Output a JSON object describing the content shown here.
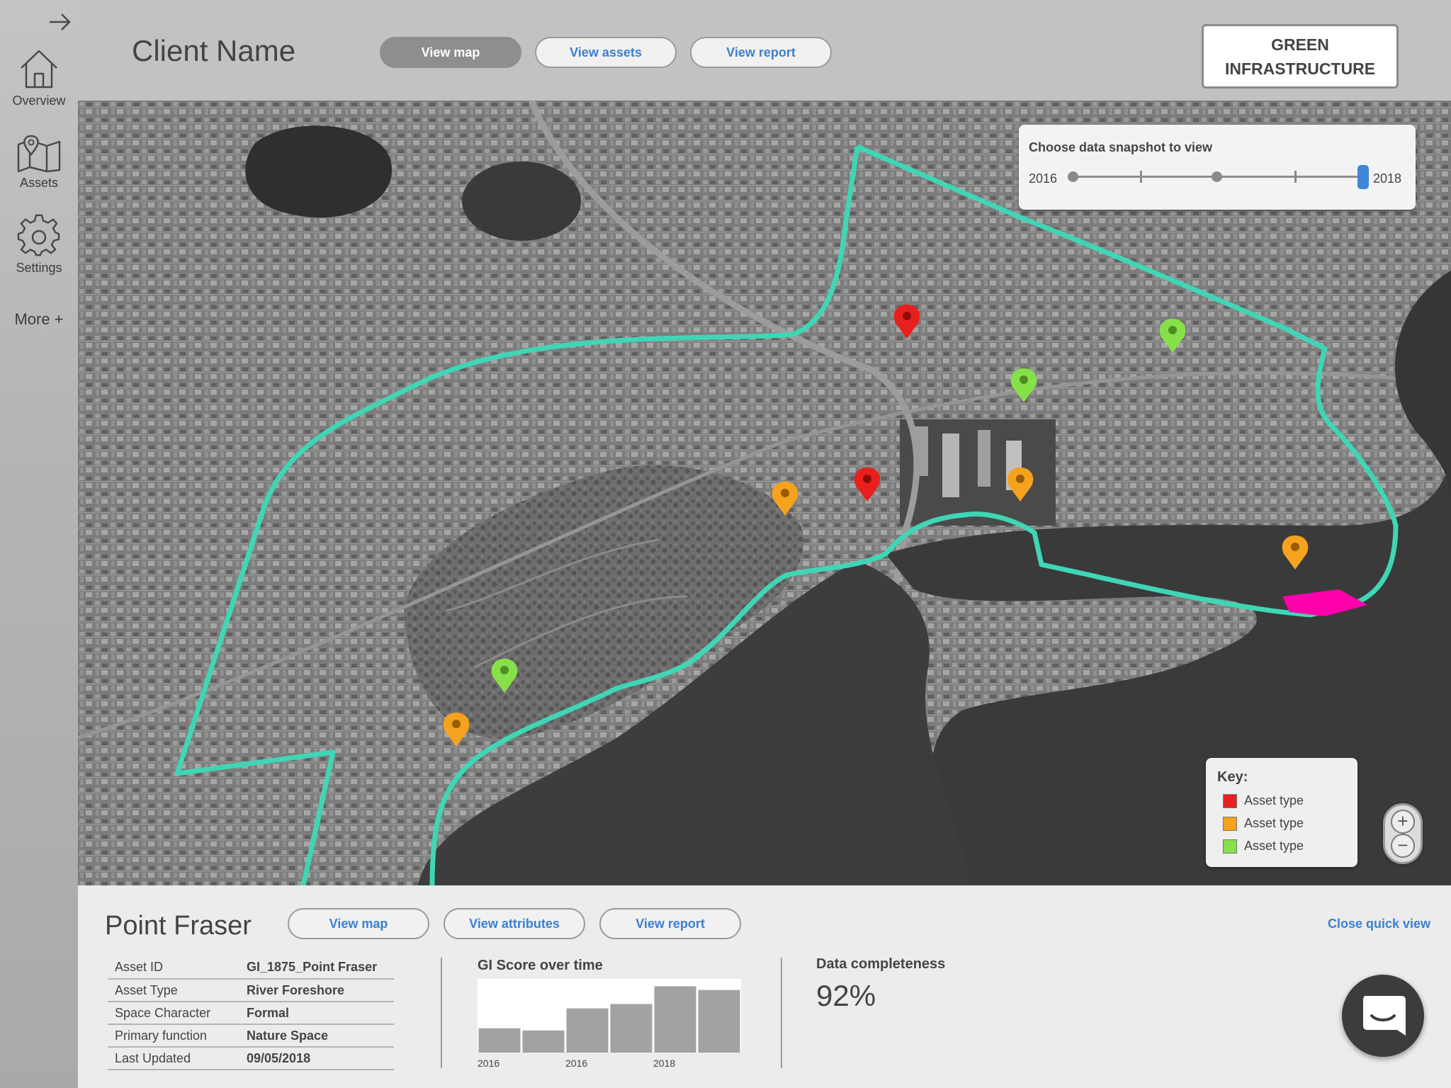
{
  "sidebar": {
    "items": [
      {
        "label": "Overview",
        "icon": "home-icon"
      },
      {
        "label": "Assets",
        "icon": "map-icon"
      },
      {
        "label": "Settings",
        "icon": "gear-icon"
      }
    ],
    "more_label": "More +"
  },
  "header": {
    "client_name": "Client Name",
    "tabs": [
      {
        "label": "View map",
        "active": true
      },
      {
        "label": "View assets",
        "active": false
      },
      {
        "label": "View report",
        "active": false
      }
    ],
    "badge_line1": "GREEN",
    "badge_line2": "INFRASTRUCTURE"
  },
  "snapshot": {
    "title": "Choose data snapshot to view",
    "start_year": "2016",
    "end_year": "2018",
    "selected_position": 1.0
  },
  "map": {
    "boundary_color": "#3fd6b6",
    "highlight_color": "#ff00aa",
    "markers": [
      {
        "status": "red"
      },
      {
        "status": "green"
      },
      {
        "status": "green"
      },
      {
        "status": "red"
      },
      {
        "status": "orange"
      },
      {
        "status": "orange"
      },
      {
        "status": "orange"
      },
      {
        "status": "green"
      },
      {
        "status": "orange"
      }
    ]
  },
  "key": {
    "title": "Key:",
    "items": [
      {
        "label": "Asset type",
        "color": "#e8201d"
      },
      {
        "label": "Asset type",
        "color": "#f5a21e"
      },
      {
        "label": "Asset type",
        "color": "#86e04a"
      }
    ]
  },
  "zoom": {
    "plus": "+",
    "minus": "−"
  },
  "quick_view": {
    "title": "Point Fraser",
    "buttons": [
      "View map",
      "View attributes",
      "View report"
    ],
    "close_label": "Close quick view",
    "attributes": [
      {
        "label": "Asset ID",
        "value": "GI_1875_Point Fraser"
      },
      {
        "label": "Asset Type",
        "value": "River Foreshore"
      },
      {
        "label": "Space Character",
        "value": "Formal"
      },
      {
        "label": "Primary function",
        "value": "Nature Space"
      },
      {
        "label": "Last Updated",
        "value": "09/05/2018"
      }
    ],
    "data_completeness_label": "Data completeness",
    "data_completeness_value": "92%"
  },
  "chart_data": {
    "type": "bar",
    "title": "GI Score over time",
    "values": [
      0.33,
      0.3,
      0.6,
      0.66,
      0.9,
      0.85
    ],
    "x_tick_labels": [
      "2016",
      "2016",
      "2018"
    ],
    "ylim": [
      0,
      1
    ],
    "grid": false
  }
}
